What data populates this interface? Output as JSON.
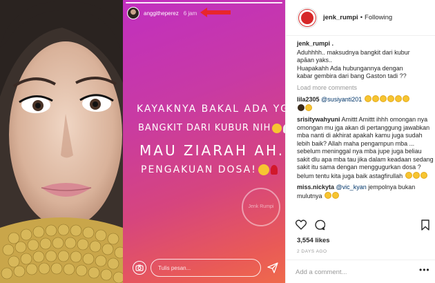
{
  "story": {
    "username": "anggitheperez",
    "time": "6 jam",
    "lines": [
      "KAYAKNYA BAKAL ADA YG",
      "BANGKIT DARI KUBUR NIH",
      "MAU ZIARAH AH....",
      "PENGAKUAN DOSA!"
    ],
    "watermark": "Jenk Rumpi",
    "reply_placeholder": "Tulis pesan..."
  },
  "post": {
    "username": "jenk_rumpi",
    "separator": "•",
    "follow_status": "Following",
    "caption_user": "jenk_rumpi .",
    "caption_lines": [
      "Aduhhhh.. maksudnya bangkit dari kubur",
      "apāan yaks..",
      "Huapakahh Ada hubungannya dengan",
      "kabar gembira dari bang Gaston tadi ??"
    ],
    "load_more": "Load more comments",
    "comments": [
      {
        "user": "lila2305",
        "mention": "@susiyanti201"
      },
      {
        "user": "srisitywahyuni",
        "text": "Amittt Amittt ihhh omongan nya omongan mu jga akan di pertanggung jawabkan mba nanti di akhirat apakah kamu juga sudah lebih baik? Allah maha pengampun mba ... sebelum meninggal nya mba jupe juga beliau sakit dlu apa mba tau jika dalam keadaan sedang sakit itu sama dengan menggugurkan dosa ? belum tentu kita juga baik astagfirullah"
      },
      {
        "user": "miss.nickyta",
        "mention": "@vic_kyan",
        "text": "jempolnya bukan mulutnya"
      }
    ],
    "likes": "3,554 likes",
    "date": "2 DAYS AGO",
    "add_comment_placeholder": "Add a comment...",
    "more": "•••"
  },
  "icons": {
    "heart": "heart-icon",
    "comment": "comment-icon",
    "bookmark": "bookmark-icon",
    "camera": "camera-icon",
    "send": "send-icon",
    "arrow": "red-arrow-icon"
  },
  "colors": {
    "story_gradient_top": "#c12fc0",
    "story_gradient_bottom": "#ef6a4c",
    "arrow": "#e8262b",
    "mention": "#003569",
    "muted": "#999999"
  }
}
